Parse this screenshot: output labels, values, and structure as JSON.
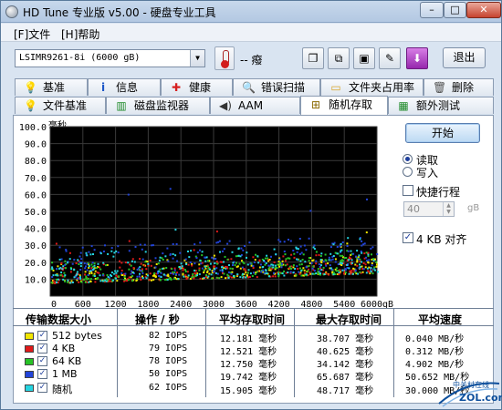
{
  "window": {
    "title": "HD Tune 专业版 v5.00 - 硬盘专业工具",
    "controls": {
      "minimize": "–",
      "maximize": "□",
      "close": "✕"
    }
  },
  "menu": {
    "file": "[F]文件",
    "help": "[H]帮助"
  },
  "toolbar": {
    "drive": "LSIMR9261-8i (6000 gB)",
    "temperature": "-- 癈",
    "exit_label": "退出",
    "icons": [
      "copy-info-icon",
      "copy-screen-icon",
      "save-icon",
      "options-icon",
      "download-icon"
    ]
  },
  "tabs_row1": [
    {
      "label": "基准",
      "icon": "bulb-icon"
    },
    {
      "label": "信息",
      "icon": "info-icon"
    },
    {
      "label": "健康",
      "icon": "plus-icon"
    },
    {
      "label": "错误扫描",
      "icon": "magnifier-icon"
    },
    {
      "label": "文件夹占用率",
      "icon": "folder-icon"
    },
    {
      "label": "删除",
      "icon": "trash-icon"
    }
  ],
  "tabs_row2": [
    {
      "label": "文件基准",
      "icon": "bulb-icon"
    },
    {
      "label": "磁盘监视器",
      "icon": "graph-icon"
    },
    {
      "label": "AAM",
      "icon": "speaker-icon"
    },
    {
      "label": "随机存取",
      "icon": "random-icon",
      "active": true
    },
    {
      "label": "额外测试",
      "icon": "tests-icon"
    }
  ],
  "controls": {
    "start_label": "开始",
    "read_label": "读取",
    "write_label": "写入",
    "short_stroke_label": "快捷行程",
    "short_stroke_value": "40",
    "short_stroke_unit": "gB",
    "align_label": "4 KB 对齐"
  },
  "chart_data": {
    "type": "scatter",
    "ylabel": "毫秒",
    "xlabel": "",
    "ylim": [
      0,
      100
    ],
    "xlim": [
      0,
      6000
    ],
    "y_ticks": [
      "100.0",
      "90.0",
      "80.0",
      "70.0",
      "60.0",
      "50.0",
      "40.0",
      "30.0",
      "20.0",
      "10.0"
    ],
    "x_ticks": [
      "0",
      "600",
      "1200",
      "1800",
      "2400",
      "3000",
      "3600",
      "4200",
      "4800",
      "5400",
      "6000gB"
    ],
    "grid": true,
    "background": "#000000",
    "series": [
      {
        "name": "512 bytes",
        "color": "#f2e600",
        "band": [
          8,
          20
        ],
        "max_ms": 38.707
      },
      {
        "name": "4 KB",
        "color": "#e01919",
        "band": [
          8,
          21
        ],
        "max_ms": 40.625
      },
      {
        "name": "64 KB",
        "color": "#27c227",
        "band": [
          8,
          22
        ],
        "max_ms": 34.142
      },
      {
        "name": "1 MB",
        "color": "#2244d8",
        "band": [
          10,
          30
        ],
        "max_ms": 65.687
      },
      {
        "name": "随机",
        "color": "#25d4e0",
        "band": [
          8,
          26
        ],
        "max_ms": 48.717
      }
    ]
  },
  "results": {
    "headers": [
      "传输数据大小",
      "操作 / 秒",
      "平均存取时间",
      "最大存取时间",
      "平均速度"
    ],
    "rows": [
      {
        "label": "512 bytes",
        "color": "#f2e600",
        "ops": "82 IOPS",
        "avg": "12.181 毫秒",
        "max": "38.707 毫秒",
        "speed": "0.040 MB/秒"
      },
      {
        "label": "4 KB",
        "color": "#e01919",
        "ops": "79 IOPS",
        "avg": "12.521 毫秒",
        "max": "40.625 毫秒",
        "speed": "0.312 MB/秒"
      },
      {
        "label": "64 KB",
        "color": "#27c227",
        "ops": "78 IOPS",
        "avg": "12.750 毫秒",
        "max": "34.142 毫秒",
        "speed": "4.902 MB/秒"
      },
      {
        "label": "1 MB",
        "color": "#2244d8",
        "ops": "50 IOPS",
        "avg": "19.742 毫秒",
        "max": "65.687 毫秒",
        "speed": "50.652 MB/秒"
      },
      {
        "label": "随机",
        "color": "#25d4e0",
        "ops": "62 IOPS",
        "avg": "15.905 毫秒",
        "max": "48.717 毫秒",
        "speed": "30.000 MB/秒"
      }
    ]
  },
  "watermark": {
    "text": "ZOL.com.cn",
    "sub": "中关村在线"
  }
}
